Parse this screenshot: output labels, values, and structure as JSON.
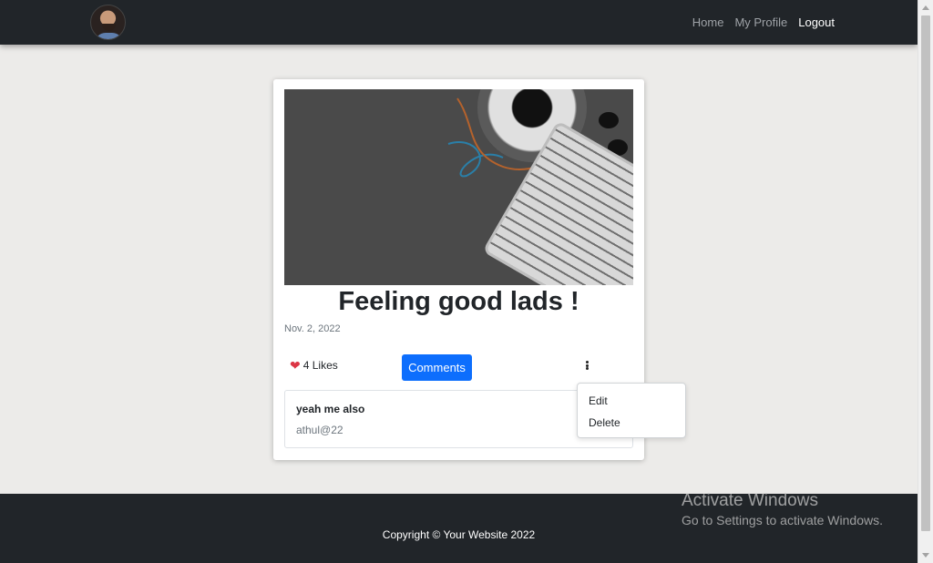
{
  "nav": {
    "links": [
      {
        "label": "Home"
      },
      {
        "label": "My Profile"
      },
      {
        "label": "Logout"
      }
    ]
  },
  "post": {
    "title": "Feeling good lads !",
    "date": "Nov. 2, 2022",
    "likes_label": "4 Likes",
    "comments_button": "Comments",
    "comment": {
      "text": "yeah me also",
      "user": "athul@22"
    }
  },
  "menu": {
    "items": [
      "Edit",
      "Delete"
    ]
  },
  "footer": {
    "copyright": "Copyright © Your Website 2022"
  },
  "watermark": {
    "title": "Activate Windows",
    "subtitle": "Go to Settings to activate Windows."
  },
  "colors": {
    "navbar": "#212529",
    "primary": "#0d6efd",
    "heart": "#dc3545",
    "page_bg": "#ecebe9"
  }
}
